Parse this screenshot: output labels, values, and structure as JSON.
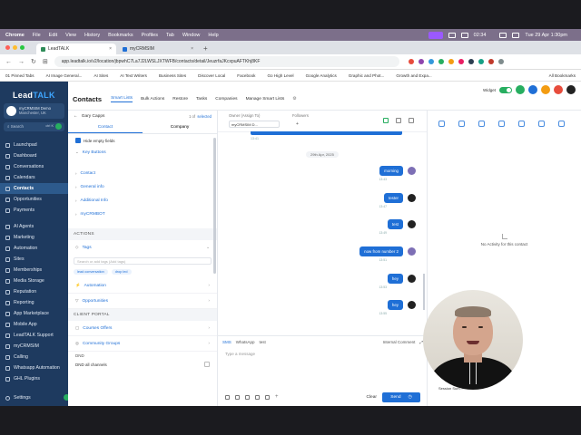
{
  "menubar": {
    "app": "Chrome",
    "items": [
      "File",
      "Edit",
      "View",
      "History",
      "Bookmarks",
      "Profiles",
      "Tab",
      "Window",
      "Help"
    ],
    "clock": "02:34",
    "datetime": "Tue 29 Apr  1:30pm"
  },
  "browser": {
    "tabs": [
      {
        "label": "LeadTALK"
      },
      {
        "label": "myCRMSIM"
      }
    ],
    "url": "app.leadtalk.io/v2/location/jbpwhC7La7J2LWSLJXTWFB/contacts/detail/JeuzrfaJKcxpuAFTKhj8KF",
    "bookmarks": [
      "01 Pinned Tabs",
      "AI Image General...",
      "AI Sites",
      "AI Text Writers",
      "Business Sites",
      "Discover Local",
      "Facebook",
      "Go High Level",
      "Google Analytics",
      "Graphic and Phot...",
      "Growth and Expa...",
      "All Bookmarks"
    ]
  },
  "sidebar": {
    "logo_a": "Lead",
    "logo_b": "TALK",
    "account_name": "myCRMSIM Demo",
    "account_sub": "Manchester, UK",
    "search": "Search",
    "search_shortcut": "ctrl K",
    "items": [
      {
        "label": "Launchpad"
      },
      {
        "label": "Dashboard"
      },
      {
        "label": "Conversations"
      },
      {
        "label": "Calendars"
      },
      {
        "label": "Contacts"
      },
      {
        "label": "Opportunities"
      },
      {
        "label": "Payments"
      },
      {
        "label": "AI Agents"
      },
      {
        "label": "Marketing"
      },
      {
        "label": "Automation"
      },
      {
        "label": "Sites"
      },
      {
        "label": "Memberships"
      },
      {
        "label": "Media Storage"
      },
      {
        "label": "Reputation"
      },
      {
        "label": "Reporting"
      },
      {
        "label": "App Marketplace"
      },
      {
        "label": "Mobile App"
      },
      {
        "label": "LeadTALK Support"
      },
      {
        "label": "myCRMSIM"
      },
      {
        "label": "Calling"
      },
      {
        "label": "Whatsapp Automation"
      },
      {
        "label": "GHL Plugins"
      }
    ],
    "settings": "Settings"
  },
  "header": {
    "title": "Contacts",
    "tabs": [
      "Smart Lists",
      "Bulk Actions",
      "Restore",
      "Tasks",
      "Companies",
      "Manage Smart Lists"
    ],
    "widget_label": "Widget"
  },
  "contact": {
    "name": "Gary Capps",
    "pager": "1 of",
    "pager_link": "selected",
    "tab_contact": "Contact",
    "tab_company": "Company",
    "hide_empty": "Hide empty fields",
    "key_buttons": "Key Buttons",
    "sections": [
      "Contact",
      "General info",
      "Additional Info",
      "myCRMBOT"
    ],
    "actions_head": "ACTIONS",
    "tags_label": "Tags",
    "tags_placeholder": "Search or add tags (Add tags)",
    "chips": [
      "lead conversation",
      "drop led"
    ],
    "automation": "Automation",
    "opportunities": "Opportunities",
    "portal_head": "CLIENT PORTAL",
    "courses": "Courses Offers",
    "community": "Community Groups",
    "dnd_head": "DND",
    "dnd_all": "DND all channels"
  },
  "conversation": {
    "owner_label": "Owner (Assign To)",
    "owner_value": "myCRMSIM D...",
    "followers_label": "Followers",
    "followers_value": "+",
    "first_ts": "13:41",
    "date_pill": "29th Apr, 2025",
    "messages": [
      {
        "text": "morning",
        "time": "13:43"
      },
      {
        "text": "tester",
        "time": "13:47"
      },
      {
        "text": "test",
        "time": "13:49"
      },
      {
        "text": "now from number 2",
        "time": "13:51"
      },
      {
        "text": "hey",
        "time": "13:53"
      },
      {
        "text": "hey",
        "time": "13:55"
      }
    ],
    "composer_tabs": [
      "SMS",
      "WhatsApp",
      "test"
    ],
    "internal_comment": "Internal Comment",
    "placeholder": "Type a message",
    "clear": "Clear",
    "send": "Send"
  },
  "activity": {
    "empty": "No Activity for this contact",
    "session": "Session Sum..."
  },
  "colors": {
    "accent": "#1f6fd6",
    "sidebar": "#1e3a5f",
    "success": "#27ae60"
  }
}
